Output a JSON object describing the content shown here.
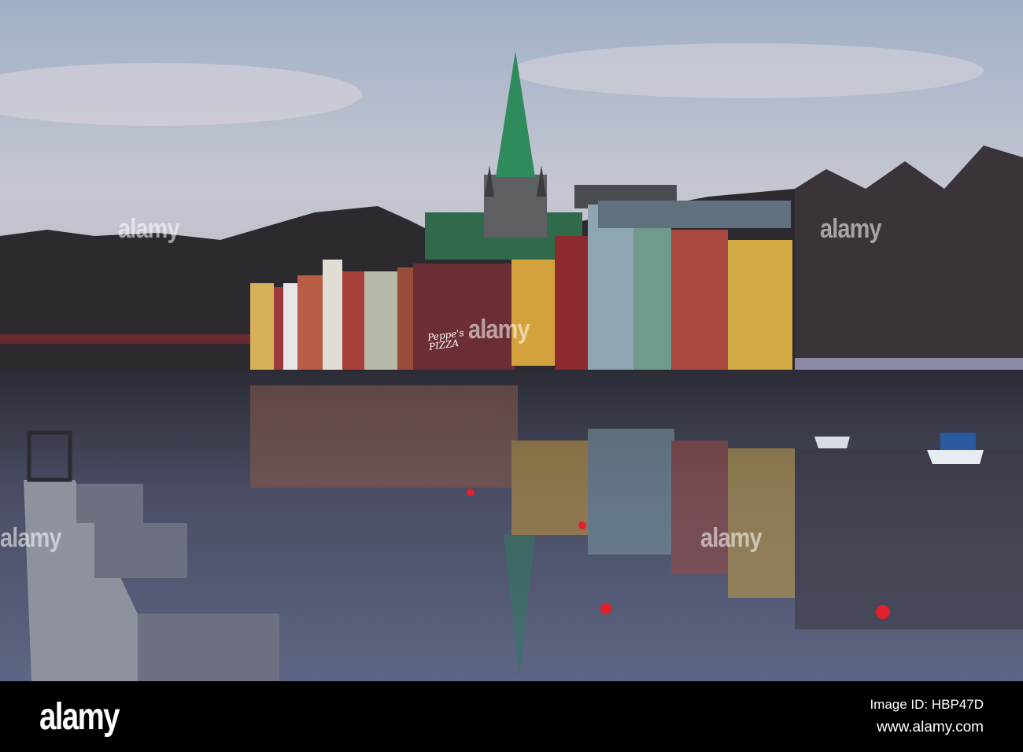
{
  "photo": {
    "subject": "Trondheim old wharves along the Nidelva river with Nidaros Cathedral spire",
    "sign_text": [
      "Peppe's",
      "PIZZA"
    ]
  },
  "watermark": {
    "text": "alamy"
  },
  "footer": {
    "logo": "alamy",
    "image_id": "Image ID: HBP47D",
    "url": "www.alamy.com"
  },
  "colors": {
    "footer_bg": "#000000",
    "sky_top": "#9fb0c6",
    "sky_bottom": "#c9c3cc",
    "water": "#3a3f52",
    "buoy": "#e0202a"
  }
}
